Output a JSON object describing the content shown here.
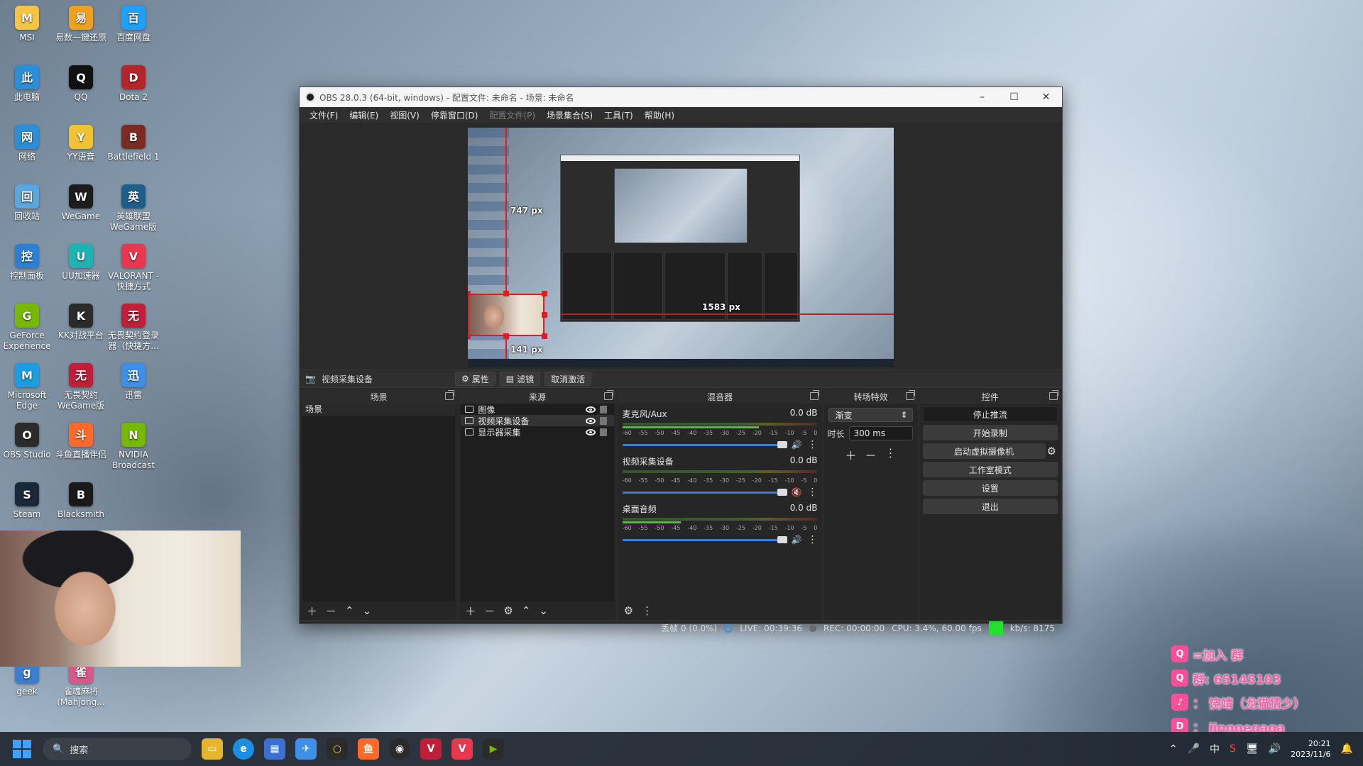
{
  "desktop_icons": [
    {
      "label": "MSI",
      "color": "#f6c443"
    },
    {
      "label": "易数一键还原",
      "color": "#f0a020"
    },
    {
      "label": "百度网盘",
      "color": "#1ea0ff"
    },
    {
      "label": "此电脑",
      "color": "#2a8fd8"
    },
    {
      "label": "QQ",
      "color": "#111111"
    },
    {
      "label": "Dota 2",
      "color": "#b3252a"
    },
    {
      "label": "网络",
      "color": "#2a8fd8"
    },
    {
      "label": "YY语音",
      "color": "#f1c232"
    },
    {
      "label": "Battlefield 1",
      "color": "#7b2b24"
    },
    {
      "label": "回收站",
      "color": "#5aa6de"
    },
    {
      "label": "WeGame",
      "color": "#1c1c1c"
    },
    {
      "label": "英雄联盟WeGame版",
      "color": "#1f5d8a"
    },
    {
      "label": "控制面板",
      "color": "#2d7fd3"
    },
    {
      "label": "UU加速器",
      "color": "#1fb2b2"
    },
    {
      "label": "VALORANT - 快捷方式",
      "color": "#e8384f"
    },
    {
      "label": "GeForce Experience",
      "color": "#76b900"
    },
    {
      "label": "KK对战平台",
      "color": "#2b2b2b"
    },
    {
      "label": "无畏契约登录器（快捷方...",
      "color": "#c01f3a"
    },
    {
      "label": "Microsoft Edge",
      "color": "#1b9de2"
    },
    {
      "label": "无畏契约WeGame版",
      "color": "#c01f3a"
    },
    {
      "label": "迅雷",
      "color": "#3d8fe8"
    },
    {
      "label": "OBS Studio",
      "color": "#2b2b2b"
    },
    {
      "label": "斗鱼直播伴侣",
      "color": "#ff6a2a"
    },
    {
      "label": "NVIDIA Broadcast",
      "color": "#76b900"
    },
    {
      "label": "Steam",
      "color": "#1b2838"
    },
    {
      "label": "Blacksmith",
      "color": "#1a1a1a"
    },
    {
      "label": "geek",
      "color": "#3b7ed0"
    },
    {
      "label": "雀魂麻将(Mahjong...",
      "color": "#d55a8a"
    }
  ],
  "overlay": {
    "line1": "=加入  群",
    "line2": "群: 65145103",
    "line3": "：  饶靖（龙猫猜少）",
    "line4": "：  jinggegaga"
  },
  "obs": {
    "title": "OBS 28.0.3 (64-bit, windows) - 配置文件: 未命名 - 场景: 未命名",
    "menu": [
      "文件(F)",
      "编辑(E)",
      "视图(V)",
      "停靠窗口(D)",
      "配置文件(P)",
      "场景集合(S)",
      "工具(T)",
      "帮助(H)"
    ],
    "preview_labels": {
      "top": "747 px",
      "right": "1583 px",
      "bottom": "141 px"
    },
    "source_toolbar": {
      "name": "视频采集设备",
      "props": "属性",
      "filters": "滤镜",
      "deactivate": "取消激活"
    },
    "docks": {
      "scenes": "场景",
      "sources": "来源",
      "mixer": "混音器",
      "transitions": "转场特效",
      "controls": "控件"
    },
    "scenes": [
      "场景"
    ],
    "sources": [
      "图像",
      "视频采集设备",
      "显示器采集"
    ],
    "mixer": [
      {
        "name": "麦克风/Aux",
        "db": "0.0 dB",
        "muted": false
      },
      {
        "name": "视频采集设备",
        "db": "0.0 dB",
        "muted": true
      },
      {
        "name": "桌面音频",
        "db": "0.0 dB",
        "muted": false
      }
    ],
    "scale_ticks": [
      "-60",
      "-55",
      "-50",
      "-45",
      "-40",
      "-35",
      "-30",
      "-25",
      "-20",
      "-15",
      "-10",
      "-5",
      "0"
    ],
    "transition": {
      "type": "渐变",
      "duration_label": "时长",
      "duration": "300 ms"
    },
    "controls": [
      "停止推流",
      "开始录制",
      "启动虚拟摄像机",
      "工作室模式",
      "设置",
      "退出"
    ],
    "status": {
      "dropped": "丢帧 0 (0.0%)",
      "live": "LIVE: 00:39:36",
      "rec": "REC: 00:00:00",
      "cpu": "CPU: 3.4%, 60.00 fps",
      "kbps": "kb/s: 8175"
    }
  },
  "taskbar": {
    "search": "搜索",
    "ime": "中",
    "time": "20:21",
    "date": "2023/11/6"
  }
}
